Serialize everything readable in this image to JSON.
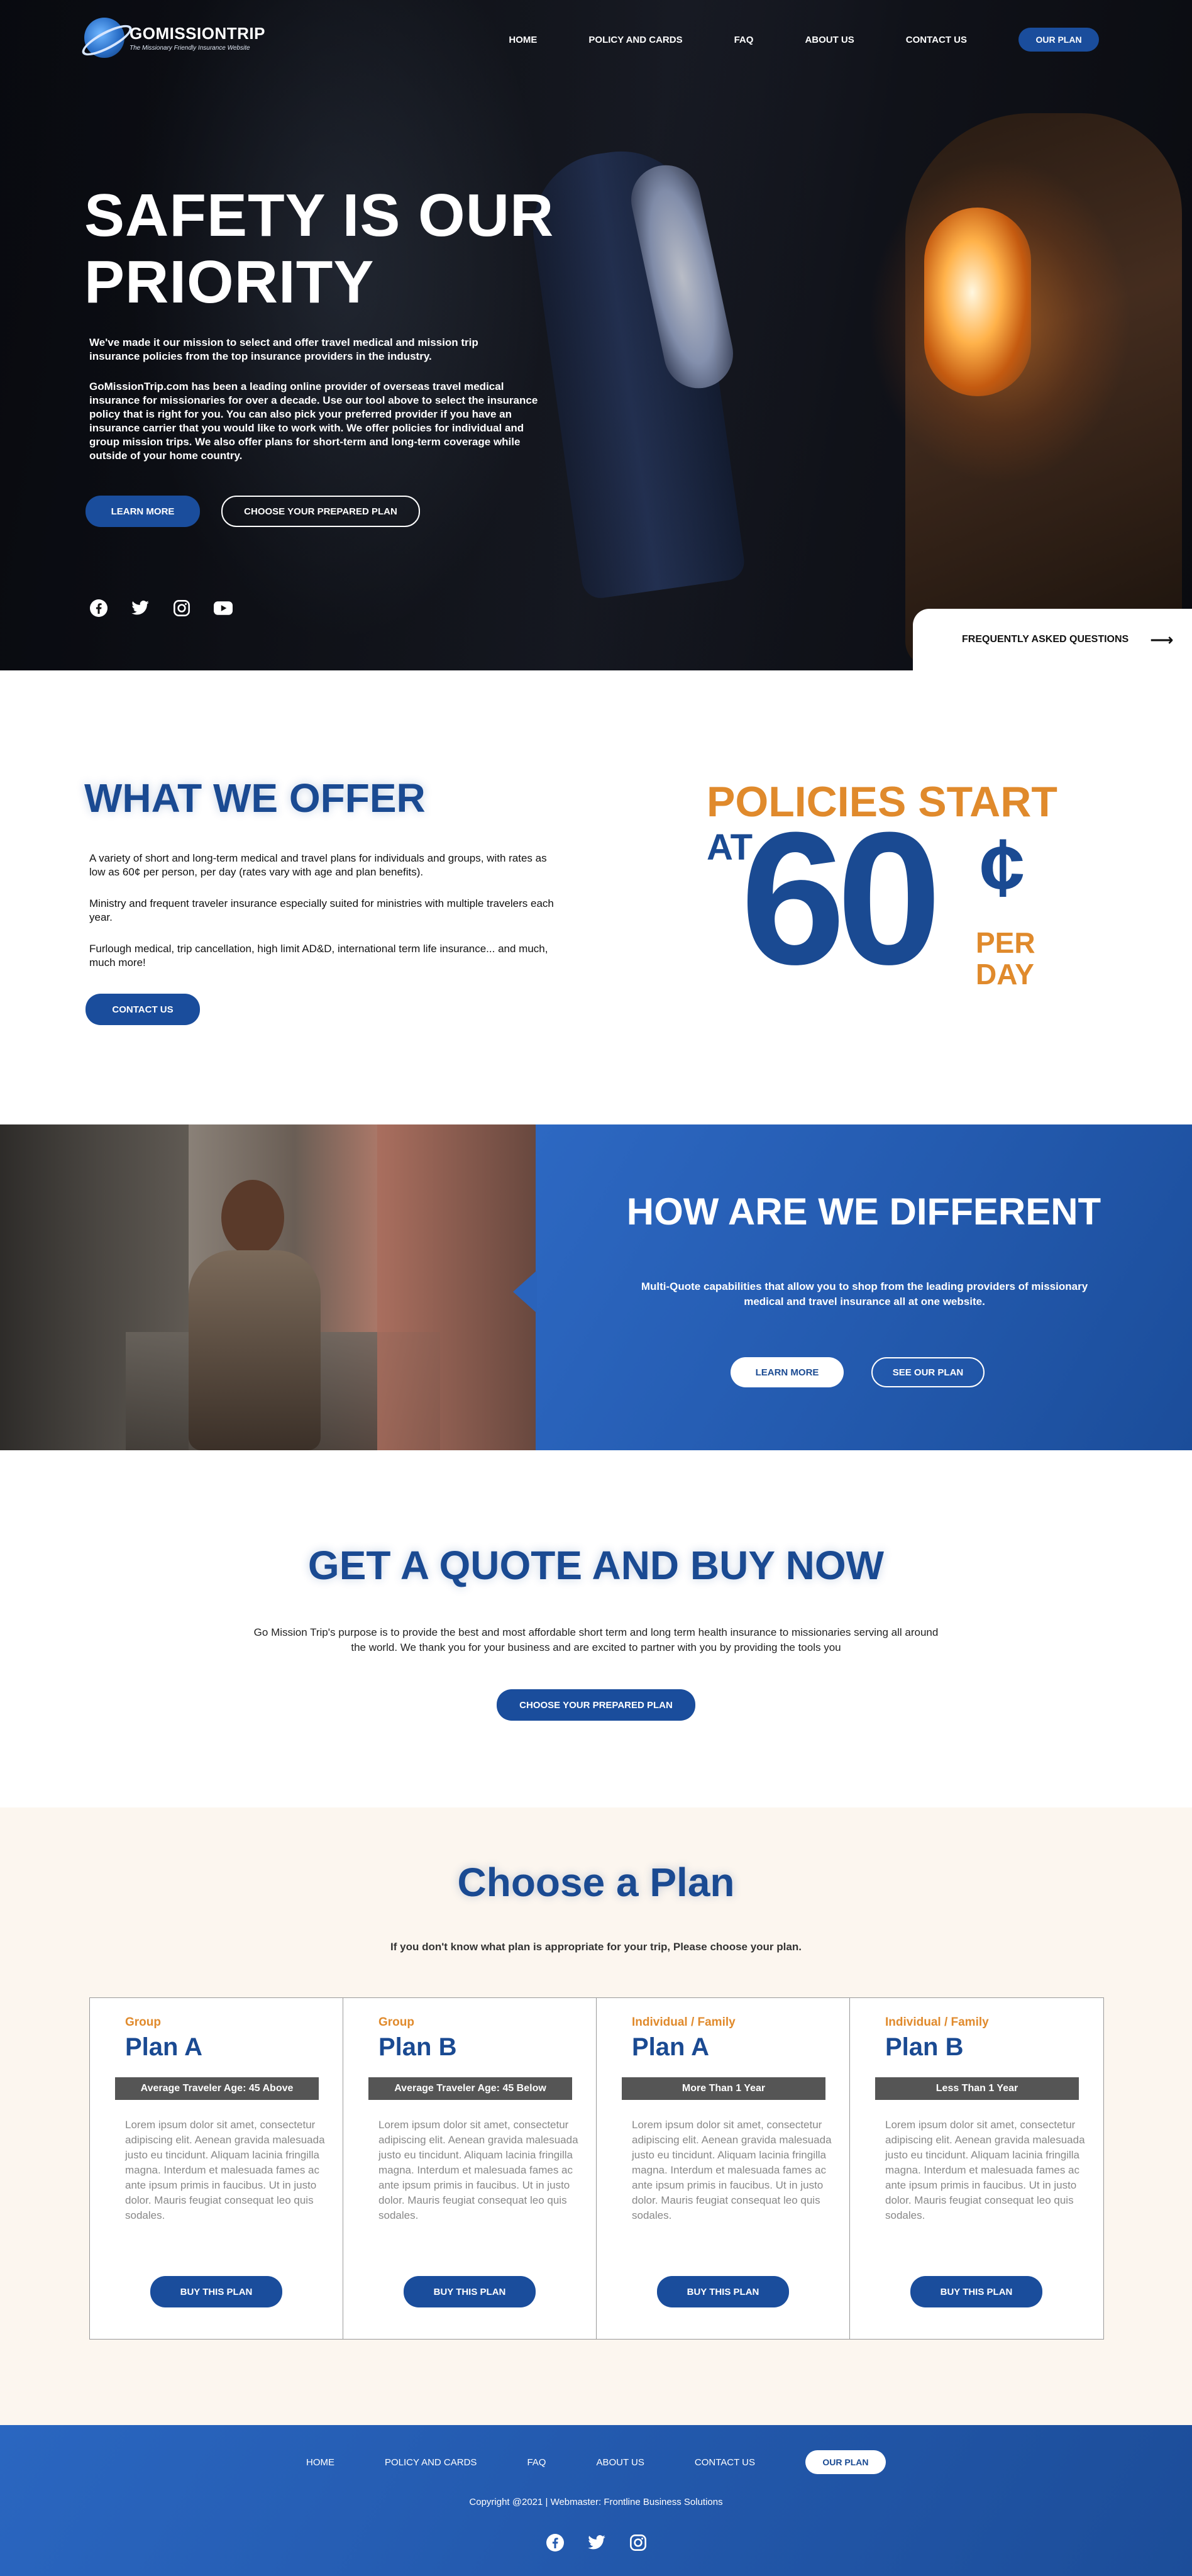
{
  "brand": {
    "name": "GOMISSIONTRIP",
    "tagline": "The Missionary Friendly Insurance Website"
  },
  "nav": {
    "home": "HOME",
    "policy": "POLICY AND CARDS",
    "faq": "FAQ",
    "about": "ABOUT US",
    "contact": "CONTACT US",
    "our_plan": "OUR PLAN"
  },
  "hero": {
    "title_line1": "SAFETY IS OUR",
    "title_line2": "PRIORITY",
    "paragraph1": "We've made it our mission to select and offer travel medical and mission trip insurance policies from the top insurance providers in the industry.",
    "paragraph2": "GoMissionTrip.com has been a leading online provider of overseas travel medical insurance for missionaries for over a decade.  Use our tool above to select the insurance policy that is right for you.  You can also pick your preferred provider if you have an insurance carrier that you would like to work with.  We offer policies for individual and group mission trips.  We also offer plans for short-term and long-term coverage while outside of your home country.",
    "learn_more": "LEARN MORE",
    "choose_plan": "CHOOSE YOUR PREPARED PLAN",
    "faq_tab": "FREQUENTLY ASKED QUESTIONS",
    "social": [
      "facebook-icon",
      "twitter-icon",
      "instagram-icon",
      "youtube-icon"
    ]
  },
  "offer": {
    "title": "WHAT WE OFFER",
    "p1": "A variety of short and long-term medical and travel plans for individuals and groups, with rates as low as 60¢ per person, per day (rates vary with age and plan benefits).",
    "p2": "Ministry and frequent traveler insurance especially suited for ministries with multiple travelers each year.",
    "p3": "Furlough medical, trip cancellation, high limit AD&D, international term life insurance... and much, much more!",
    "contact": "CONTACT US",
    "policies_line1": "POLICIES START",
    "policies_at": "AT",
    "policies_amount": "60",
    "policies_cent": "¢",
    "policies_per": "PER",
    "policies_day": "DAY"
  },
  "different": {
    "title": "HOW ARE WE DIFFERENT",
    "text": "Multi-Quote capabilities that allow you to shop from the leading providers of missionary medical and travel insurance all at one website.",
    "learn_more": "LEARN MORE",
    "see_plan": "SEE OUR PLAN"
  },
  "quote": {
    "title": "GET A QUOTE AND BUY NOW",
    "text": "Go Mission Trip's purpose is to provide the best and most affordable short term and long term health insurance to missionaries serving all around the world. We thank you for your business and are excited to partner with you by providing the tools you",
    "button": "CHOOSE YOUR PREPARED PLAN"
  },
  "plans": {
    "title": "Choose a Plan",
    "subtitle": "If you don't know what plan is appropriate for your trip, Please choose your plan.",
    "items": [
      {
        "category": "Group",
        "name": "Plan A",
        "badge": "Average Traveler Age: 45 Above",
        "description": "Lorem ipsum dolor sit amet, consectetur adipiscing elit. Aenean gravida malesuada justo eu tincidunt. Aliquam lacinia fringilla magna. Interdum et malesuada fames ac ante ipsum primis in faucibus. Ut in justo dolor. Mauris feugiat consequat leo quis sodales.",
        "button": "BUY THIS PLAN"
      },
      {
        "category": "Group",
        "name": "Plan B",
        "badge": "Average Traveler Age: 45 Below",
        "description": "Lorem ipsum dolor sit amet, consectetur adipiscing elit. Aenean gravida malesuada justo eu tincidunt. Aliquam lacinia fringilla magna. Interdum et malesuada fames ac ante ipsum primis in faucibus. Ut in justo dolor. Mauris feugiat consequat leo quis sodales.",
        "button": "BUY THIS PLAN"
      },
      {
        "category": "Individual / Family",
        "name": "Plan A",
        "badge": "More Than 1 Year",
        "description": "Lorem ipsum dolor sit amet, consectetur adipiscing elit. Aenean gravida malesuada justo eu tincidunt. Aliquam lacinia fringilla magna. Interdum et malesuada fames ac ante ipsum primis in faucibus. Ut in justo dolor. Mauris feugiat consequat leo quis sodales.",
        "button": "BUY THIS PLAN"
      },
      {
        "category": "Individual / Family",
        "name": "Plan B",
        "badge": "Less Than 1 Year",
        "description": "Lorem ipsum dolor sit amet, consectetur adipiscing elit. Aenean gravida malesuada justo eu tincidunt. Aliquam lacinia fringilla magna. Interdum et malesuada fames ac ante ipsum primis in faucibus. Ut in justo dolor. Mauris feugiat consequat leo quis sodales.",
        "button": "BUY THIS PLAN"
      }
    ]
  },
  "footer": {
    "nav": {
      "home": "HOME",
      "policy": "POLICY AND CARDS",
      "faq": "FAQ",
      "about": "ABOUT US",
      "contact": "CONTACT US",
      "our_plan": "OUR PLAN"
    },
    "copyright": "Copyright @2021 | Webmaster: Frontline Business Solutions",
    "social": [
      "facebook-icon",
      "twitter-icon",
      "instagram-icon"
    ]
  },
  "colors": {
    "primary": "#1a4d9c",
    "accent": "#e08a2c",
    "panel": "#2a63bb",
    "plans_bg": "#fcf6ef",
    "badge": "#555555"
  }
}
